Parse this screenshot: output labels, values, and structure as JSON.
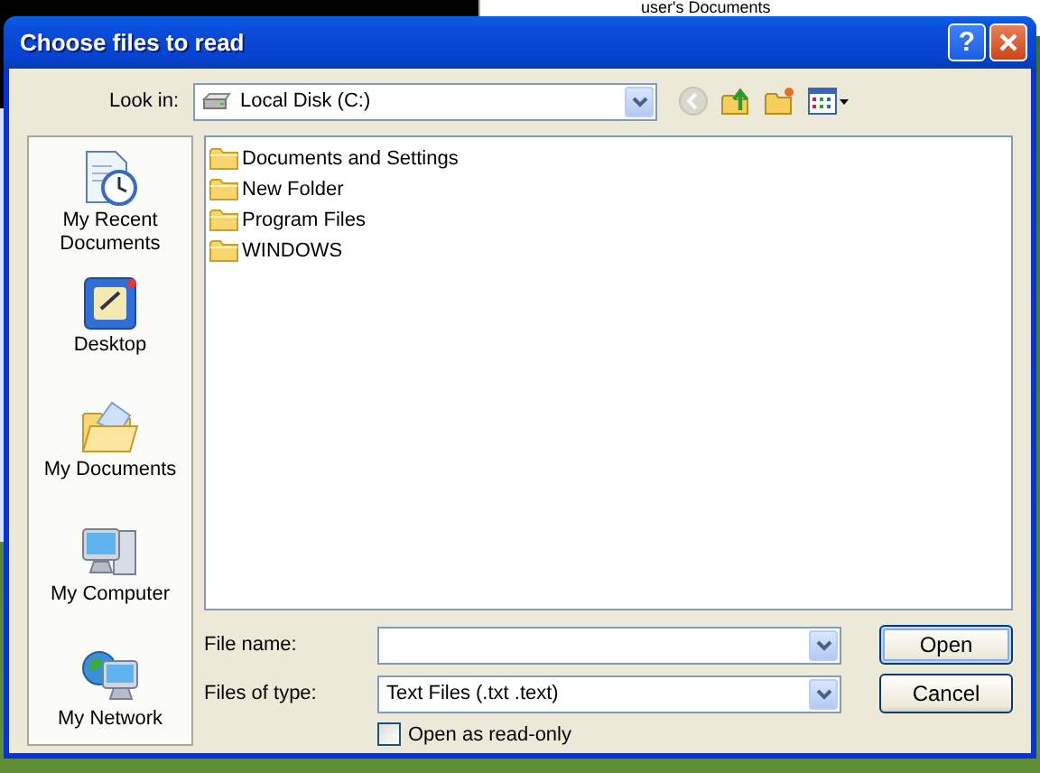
{
  "background": {
    "tree_item": "user's Documents"
  },
  "window": {
    "title": "Choose files to read",
    "help": "?"
  },
  "look_in": {
    "label": "Look in:",
    "value": "Local Disk (C:)"
  },
  "toolbar": [
    {
      "kind": "back",
      "disabled": true
    },
    {
      "kind": "up",
      "disabled": false
    },
    {
      "kind": "new_folder",
      "disabled": false
    },
    {
      "kind": "views",
      "disabled": false
    }
  ],
  "places": [
    {
      "kind": "recent",
      "label": "My Recent Documents"
    },
    {
      "kind": "desktop",
      "label": "Desktop"
    },
    {
      "kind": "documents",
      "label": "My Documents"
    },
    {
      "kind": "computer",
      "label": "My Computer"
    },
    {
      "kind": "network",
      "label": "My Network"
    }
  ],
  "files": [
    {
      "name": "Documents and Settings"
    },
    {
      "name": "New Folder"
    },
    {
      "name": "Program Files"
    },
    {
      "name": "WINDOWS"
    }
  ],
  "file_name": {
    "label": "File name:"
  },
  "file_type": {
    "label": "Files of type:",
    "value": "Text Files (.txt .text)"
  },
  "read_only": {
    "label": "Open as read-only",
    "checked": false
  },
  "buttons": [
    {
      "label": "Open",
      "default": true
    },
    {
      "label": "Cancel",
      "default": false
    }
  ]
}
